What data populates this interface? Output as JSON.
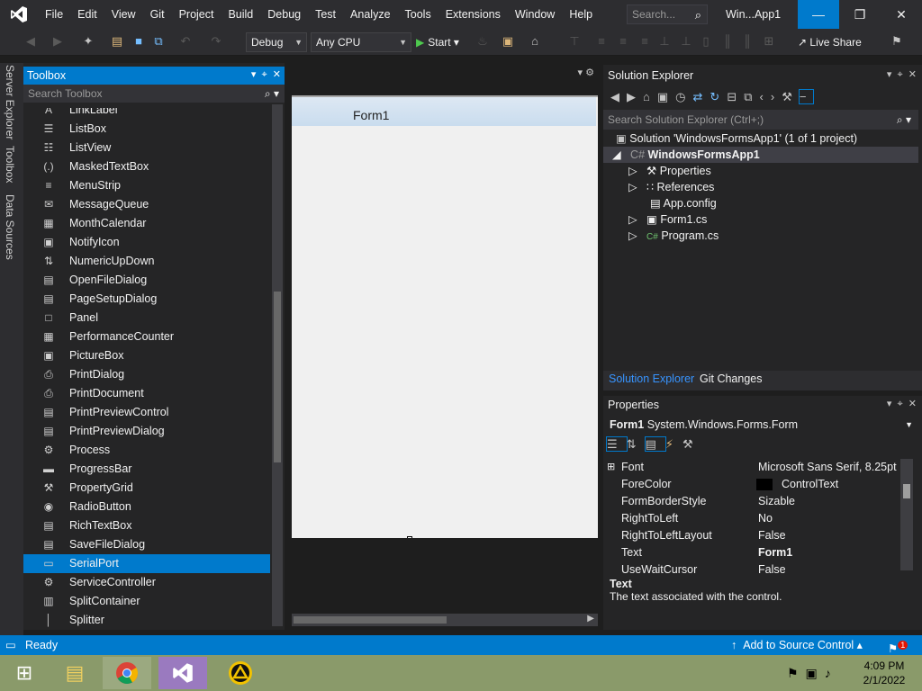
{
  "menu": [
    "File",
    "Edit",
    "View",
    "Git",
    "Project",
    "Build",
    "Debug",
    "Test",
    "Analyze",
    "Tools",
    "Extensions",
    "Window",
    "Help"
  ],
  "search": {
    "placeholder": "Search..."
  },
  "window_title": "Win...App1",
  "toolbar": {
    "config": "Debug",
    "platform": "Any CPU",
    "start": "Start",
    "liveshare": "Live Share"
  },
  "side_tabs": [
    "Server Explorer",
    "Toolbox",
    "Data Sources"
  ],
  "toolbox": {
    "title": "Toolbox",
    "search_placeholder": "Search Toolbox",
    "items": [
      "LinkLabel",
      "ListBox",
      "ListView",
      "MaskedTextBox",
      "MenuStrip",
      "MessageQueue",
      "MonthCalendar",
      "NotifyIcon",
      "NumericUpDown",
      "OpenFileDialog",
      "PageSetupDialog",
      "Panel",
      "PerformanceCounter",
      "PictureBox",
      "PrintDialog",
      "PrintDocument",
      "PrintPreviewControl",
      "PrintPreviewDialog",
      "Process",
      "ProgressBar",
      "PropertyGrid",
      "RadioButton",
      "RichTextBox",
      "SaveFileDialog",
      "SerialPort",
      "ServiceController",
      "SplitContainer",
      "Splitter"
    ],
    "selected": "SerialPort"
  },
  "designer": {
    "form_title": "Form1"
  },
  "solution_explorer": {
    "title": "Solution Explorer",
    "search_placeholder": "Search Solution Explorer (Ctrl+;)",
    "solution": "Solution 'WindowsFormsApp1' (1 of 1 project)",
    "project": "WindowsFormsApp1",
    "nodes": [
      "Properties",
      "References",
      "App.config",
      "Form1.cs",
      "Program.cs"
    ],
    "tabs": [
      "Solution Explorer",
      "Git Changes"
    ]
  },
  "properties": {
    "title": "Properties",
    "object": "Form1",
    "object_type": "System.Windows.Forms.Form",
    "rows": [
      {
        "name": "Font",
        "value": "Microsoft Sans Serif, 8.25pt"
      },
      {
        "name": "ForeColor",
        "value": "ControlText"
      },
      {
        "name": "FormBorderStyle",
        "value": "Sizable"
      },
      {
        "name": "RightToLeft",
        "value": "No"
      },
      {
        "name": "RightToLeftLayout",
        "value": "False"
      },
      {
        "name": "Text",
        "value": "Form1"
      },
      {
        "name": "UseWaitCursor",
        "value": "False"
      }
    ],
    "desc_title": "Text",
    "desc_text": "The text associated with the control."
  },
  "status": {
    "ready": "Ready",
    "source_control": "Add to Source Control",
    "notifications": "1"
  },
  "taskbar": {
    "time": "4:09 PM",
    "date": "2/1/2022"
  },
  "colors": {
    "accent": "#007acc",
    "background": "#1e1e1e",
    "panel": "#252526"
  }
}
